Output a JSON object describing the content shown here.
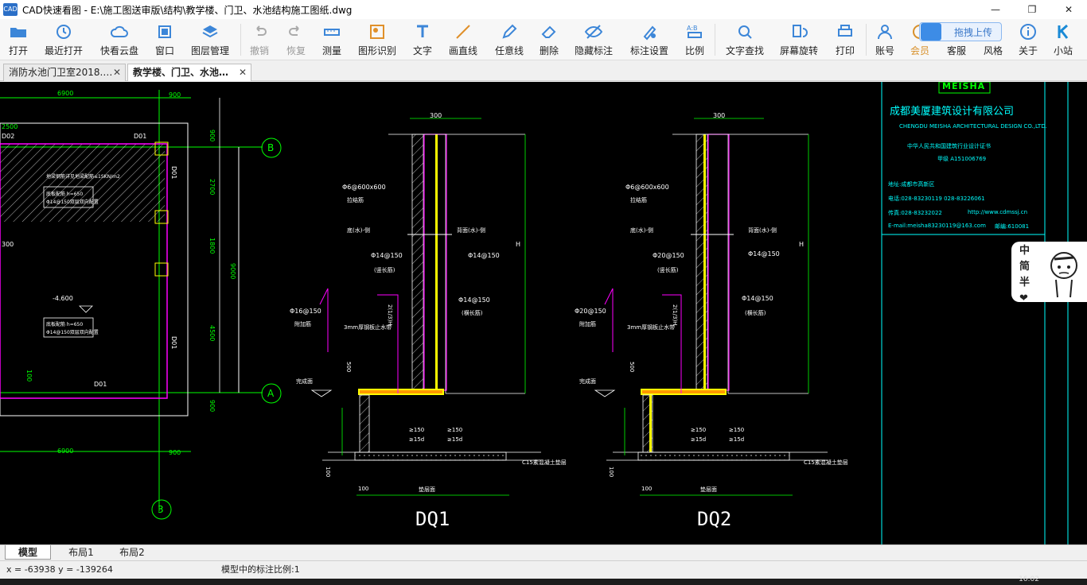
{
  "window": {
    "logo": "CAD",
    "title": "CAD快速看图 - E:\\施工图送审版\\结构\\教学楼、门卫、水池结构施工图纸.dwg",
    "minimize_glyph": "—",
    "maximize_glyph": "❐",
    "close_glyph": "✕"
  },
  "toolbar": {
    "items": [
      {
        "label": "打开",
        "icon": "folder-icon"
      },
      {
        "label": "最近打开",
        "icon": "recent-icon"
      },
      {
        "label": "快看云盘",
        "icon": "cloud-icon"
      },
      {
        "label": "窗口",
        "icon": "window-icon"
      },
      {
        "label": "图层管理",
        "icon": "layers-icon"
      },
      {
        "label": "撤销",
        "icon": "undo-icon"
      },
      {
        "label": "恢复",
        "icon": "redo-icon"
      },
      {
        "label": "测量",
        "icon": "ruler-icon"
      },
      {
        "label": "图形识别",
        "icon": "shape-recognize-icon"
      },
      {
        "label": "文字",
        "icon": "text-icon"
      },
      {
        "label": "画直线",
        "icon": "line-icon"
      },
      {
        "label": "任意线",
        "icon": "pen-icon"
      },
      {
        "label": "删除",
        "icon": "eraser-icon"
      },
      {
        "label": "隐藏标注",
        "icon": "eye-hide-icon"
      },
      {
        "label": "标注设置",
        "icon": "annotate-settings-icon"
      },
      {
        "label": "比例",
        "icon": "scale-icon"
      },
      {
        "label": "文字查找",
        "icon": "text-search-icon"
      },
      {
        "label": "屏幕旋转",
        "icon": "rotate-icon"
      },
      {
        "label": "打印",
        "icon": "printer-icon"
      },
      {
        "label": "账号",
        "icon": "user-icon"
      },
      {
        "label": "会员",
        "icon": "vip-icon"
      },
      {
        "label": "客服",
        "icon": "support-icon"
      },
      {
        "label": "风格",
        "icon": "style-icon"
      },
      {
        "label": "关于",
        "icon": "info-icon"
      },
      {
        "label": "小站",
        "icon": "k-icon"
      }
    ],
    "upload_label": "拖拽上传"
  },
  "tabs": [
    {
      "label": "消防水池门卫室2018.…",
      "close": "✕"
    },
    {
      "label": "教学楼、门卫、水池…",
      "close": "✕"
    }
  ],
  "drawing": {
    "plan": {
      "dims": [
        "6900",
        "900",
        "2500",
        "D02",
        "D01",
        "D01",
        "2700",
        "1800",
        "4500",
        "900",
        "9000",
        "900",
        "300",
        "-4.600",
        "D01",
        "D01",
        "100",
        "6900",
        "900"
      ],
      "axis_labels": [
        "B",
        "A",
        "3"
      ],
      "notes": [
        "地梁钢筋详见地梁配筋≤1SKN/m2",
        "底板配筋 h=650",
        "Φ14@150双层双向配置",
        "底板配筋 h=650",
        "Φ14@150双层双向配置"
      ]
    },
    "dq1": {
      "title": "DQ1",
      "labels": [
        "300",
        "Φ6@600x600",
        "拉结筋",
        "Φ14@150",
        "(竖长筋)",
        "Φ14@150",
        "Φ14@150",
        "(横长筋)",
        "Φ16@150",
        "附加筋",
        "3mm厚钢板止水带",
        "底(水)-侧",
        "背面(水)-侧",
        "500",
        "C15素混凝土垫层",
        "完成面",
        "100",
        "100",
        "垫层面",
        "H",
        "2(1/3)H",
        "≥150",
        "≥15d",
        "≥150",
        "≥15d"
      ]
    },
    "dq2": {
      "title": "DQ2",
      "labels": [
        "300",
        "Φ6@600x600",
        "拉结筋",
        "Φ20@150",
        "(竖长筋)",
        "Φ14@150",
        "Φ14@150",
        "(横长筋)",
        "Φ20@150",
        "附加筋",
        "3mm厚钢板止水带",
        "底(水)-侧",
        "背面(水)-侧",
        "500",
        "C15素混凝土垫层",
        "完成面",
        "100",
        "100",
        "垫层面",
        "H",
        "2(1/3)H",
        "≥150",
        "≥15d",
        "≥150",
        "≥15d"
      ]
    },
    "titleblock": {
      "brand": "MEISHA",
      "company_cn": "成都美厦建筑设计有限公司",
      "company_en": "CHENGDU MEISHA ARCHITECTURAL DESIGN CO.,LTD.",
      "cert_line": "中华人民共和国建筑行业设计证书",
      "cert_no": "甲级 A151006769",
      "address": "地址:成都市高新区",
      "tel": "电话:028-83230119  028-83226061",
      "fax": "传真:028-83232022",
      "web": "http://www.cdmssj.cn",
      "email": "E-mail:meisha83230119@163.com",
      "zip": "邮编:610081"
    },
    "ime": [
      "中",
      "简",
      "半",
      "❤"
    ]
  },
  "layout_tabs": [
    "模型",
    "布局1",
    "布局2"
  ],
  "status": {
    "coords": "x = -63938  y = -139264",
    "scale": "模型中的标注比例:1"
  },
  "taskbar": {
    "clock": "16:02"
  },
  "colors": {
    "green": "#00ff00",
    "magenta": "#ff00ff",
    "yellow": "#ffff00",
    "cyan": "#00ffff",
    "white": "#ffffff",
    "canvas": "#000000"
  }
}
